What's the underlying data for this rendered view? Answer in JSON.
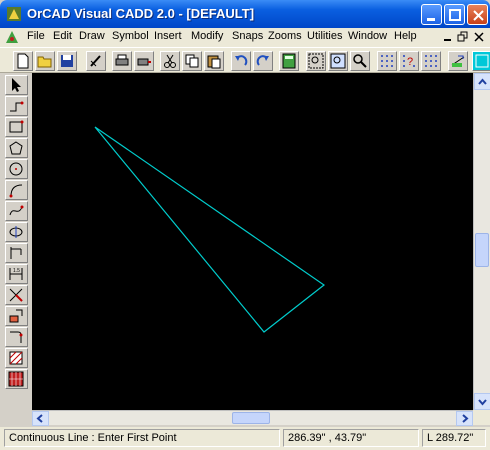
{
  "window": {
    "title": "OrCAD Visual CADD 2.0 - [DEFAULT]",
    "controls": [
      "minimize",
      "maximize",
      "close"
    ]
  },
  "menubar": {
    "items": [
      "File",
      "Edit",
      "Draw",
      "Symbol",
      "Insert",
      "Modify",
      "Snaps",
      "Zooms",
      "Utilities",
      "Window",
      "Help"
    ]
  },
  "toolbar": {
    "icons": [
      "new-icon",
      "open-icon",
      "save-icon",
      "pen-icon",
      "print-icon",
      "print-setup-icon",
      "cut-icon",
      "copy-icon",
      "paste-icon",
      "undo-icon",
      "redo-icon",
      "calculator-icon",
      "zoom-window-icon",
      "zoom-extents-icon",
      "zoom-icon",
      "snap-grid-icon",
      "snap-query-icon",
      "snap-grid-2-icon",
      "layer-icon",
      "cyan-tool-icon"
    ]
  },
  "left_toolbar": {
    "icons": [
      "pointer-icon",
      "line-icon",
      "rectangle-icon",
      "polygon-icon",
      "circle-icon",
      "arc-icon",
      "curve-icon",
      "ellipse-icon",
      "linear-dimension-icon",
      "dimension-icon",
      "trim-icon",
      "offset-icon",
      "fillet-icon",
      "hatch-icon",
      "symbol-icon"
    ]
  },
  "drawing": {
    "line_color": "#00cccc",
    "background": "#000000"
  },
  "statusbar": {
    "prompt": "Continuous Line : Enter First Point",
    "coordinates": "286.39\" , 43.79\"",
    "length": "L 289.72\""
  }
}
